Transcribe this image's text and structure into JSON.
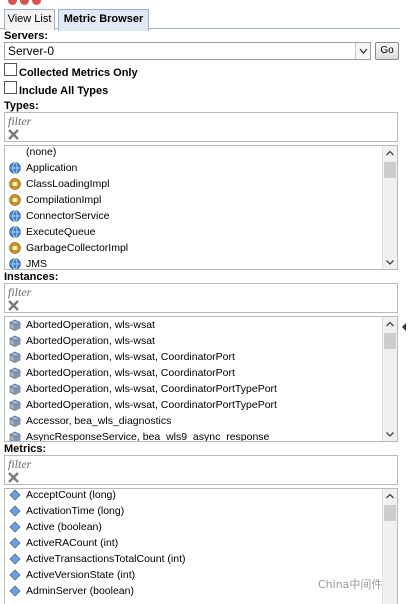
{
  "tabs": {
    "view_list": "View List",
    "metric_browser": "Metric Browser"
  },
  "servers": {
    "label": "Servers:",
    "selected": "Server-0",
    "go_label": "Go"
  },
  "options": {
    "collected_metrics_only": "Collected Metrics Only",
    "include_all_types": "Include All Types"
  },
  "types": {
    "label": "Types:",
    "filter_placeholder": "filter",
    "items": [
      {
        "label": "(none)",
        "icon": "none"
      },
      {
        "label": "Application",
        "icon": "globe-icon"
      },
      {
        "label": "ClassLoadingImpl",
        "icon": "bean-icon"
      },
      {
        "label": "CompilationImpl",
        "icon": "bean-icon"
      },
      {
        "label": "ConnectorService",
        "icon": "globe-icon"
      },
      {
        "label": "ExecuteQueue",
        "icon": "globe-icon"
      },
      {
        "label": "GarbageCollectorImpl",
        "icon": "bean-icon"
      },
      {
        "label": "JMS",
        "icon": "globe-icon"
      }
    ]
  },
  "instances": {
    "label": "Instances:",
    "filter_placeholder": "filter",
    "items": [
      "AbortedOperation, wls-wsat",
      "AbortedOperation, wls-wsat",
      "AbortedOperation, wls-wsat, CoordinatorPort",
      "AbortedOperation, wls-wsat, CoordinatorPort",
      "AbortedOperation, wls-wsat, CoordinatorPortTypePort",
      "AbortedOperation, wls-wsat, CoordinatorPortTypePort",
      "Accessor, bea_wls_diagnostics",
      "AsyncResponseService, bea_wls9_async_response"
    ]
  },
  "metrics": {
    "label": "Metrics:",
    "filter_placeholder": "filter",
    "items": [
      "AcceptCount (long)",
      "ActivationTime (long)",
      "Active (boolean)",
      "ActiveRACount (int)",
      "ActiveTransactionsTotalCount (int)",
      "ActiveVersionState (int)",
      "AdminServer (boolean)"
    ]
  },
  "watermark": "China中间件",
  "colors": {
    "tab_active": "#dfe9f5",
    "border": "#b9b9b9",
    "globe": "#3b7fd0",
    "bean": "#e0a21a",
    "diamond": "#6a9fdc"
  }
}
